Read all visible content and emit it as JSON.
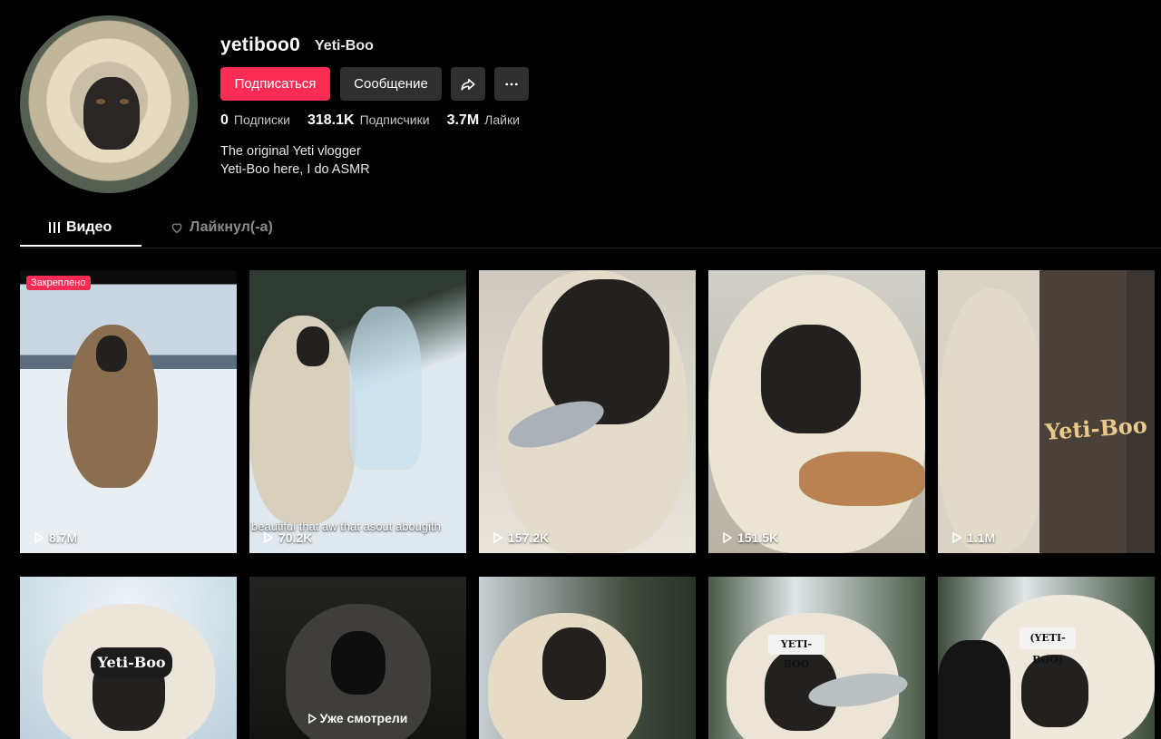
{
  "profile": {
    "username": "yetiboo0",
    "nickname": "Yeti-Boo",
    "follow_label": "Подписаться",
    "message_label": "Сообщение",
    "stats": [
      {
        "value": "0",
        "label": "Подписки"
      },
      {
        "value": "318.1K",
        "label": "Подписчики"
      },
      {
        "value": "3.7M",
        "label": "Лайки"
      }
    ],
    "bio_line1": "The original Yeti vlogger",
    "bio_line2": "Yeti-Boo here, I do ASMR"
  },
  "tabs": {
    "videos_label": "Видео",
    "liked_label": "Лайкнул(-а)"
  },
  "videos": [
    {
      "views": "8.7M",
      "pinned_label": "Закреплено"
    },
    {
      "views": "70.2K",
      "caption": "beautiful that aw that asout abougith"
    },
    {
      "views": "157.2K"
    },
    {
      "views": "151.5K"
    },
    {
      "views": "1.1M",
      "sign": "Yeti-Boo"
    },
    {
      "sign": "Yeti-Boo"
    },
    {
      "watched_label": "Уже смотрели"
    },
    {},
    {
      "sign": "YETI-BOO"
    },
    {
      "sign": "(YETI-BOO)"
    }
  ],
  "colors": {
    "accent": "#fe2c55",
    "button_bg": "#2f2f2f",
    "background": "#000000"
  }
}
